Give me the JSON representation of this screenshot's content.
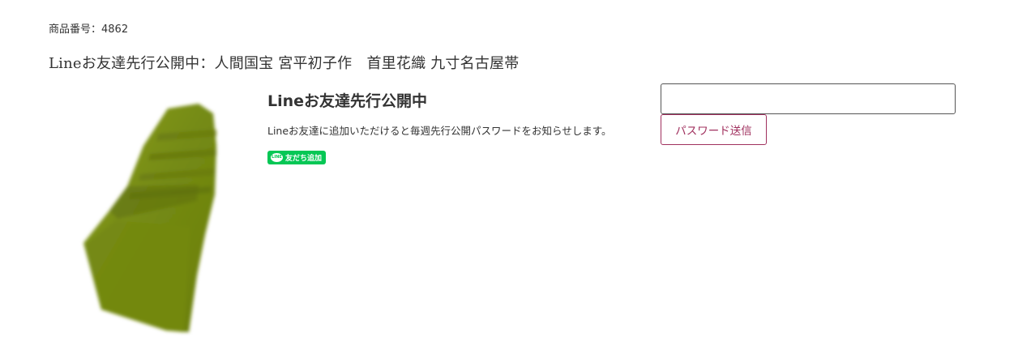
{
  "product": {
    "number_label": "商品番号：4862",
    "title": "Lineお友達先行公開中：人間国宝 宮平初子作　首里花織 九寸名古屋帯",
    "image_color": "#7a8d14"
  },
  "notice": {
    "heading": "Lineお友達先行公開中",
    "text": "Lineお友達に追加いただけると毎週先行公開パスワードをお知らせします。",
    "line_button_label": "友だち追加",
    "line_icon_text": "LINE",
    "line_color": "#06c755"
  },
  "password_form": {
    "input_value": "",
    "submit_label": "パスワード送信",
    "accent_color": "#a0305e"
  }
}
